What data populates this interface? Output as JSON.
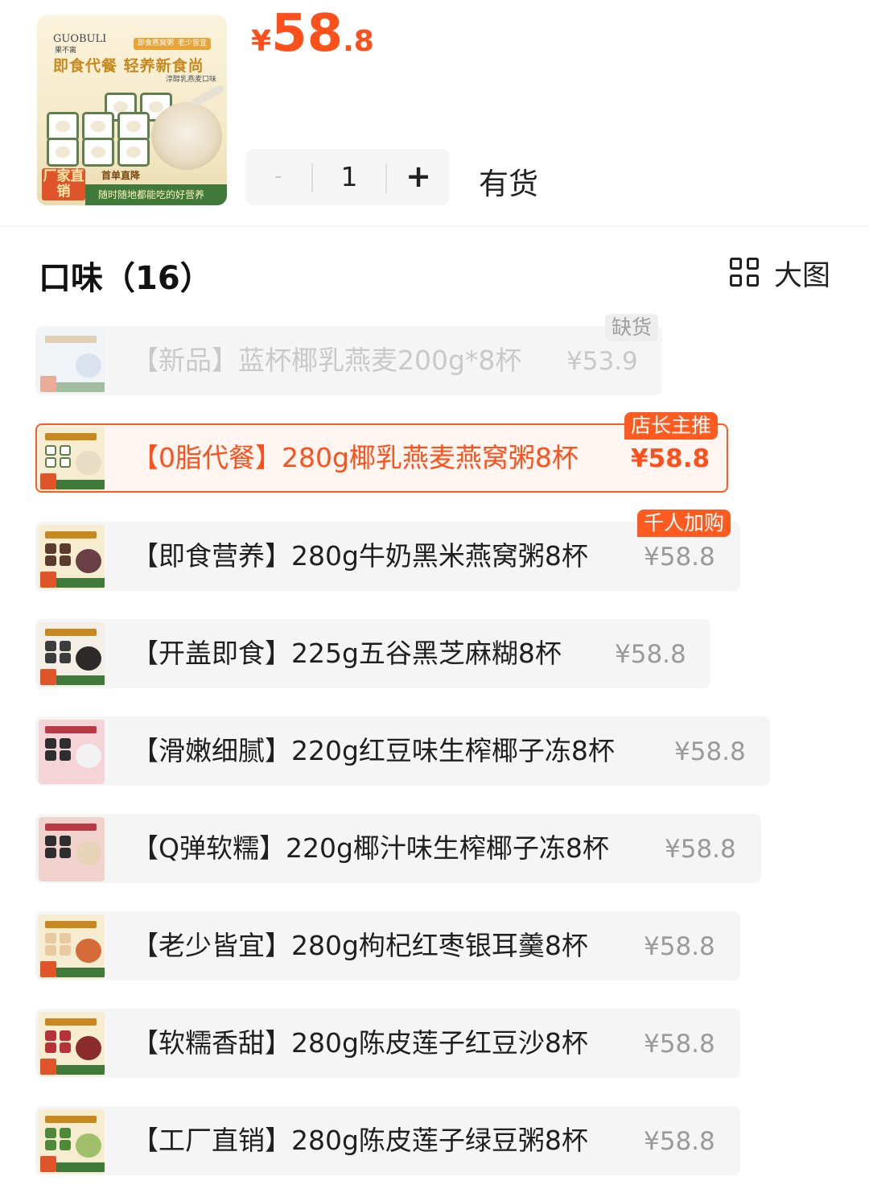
{
  "product": {
    "thumbnail": {
      "brand": "GUOBULI",
      "brand_sub": "果不离",
      "tag_a": "即食燕窝粥",
      "tag_b": "老少皆宜",
      "headline": "即食代餐 轻养新食尚",
      "subline": "淳醇乳燕麦口味",
      "factory": "厂家直销",
      "first_drop": "首单直降",
      "banner": "随时随地都能吃的好营养"
    },
    "price": {
      "currency": "¥",
      "integer": "58",
      "decimal": ".8"
    },
    "stepper": {
      "minus": "-",
      "quantity": "1",
      "plus": "+"
    },
    "stock": "有货"
  },
  "flavors": {
    "title": "口味（16）",
    "big_view_label": "大图",
    "big_view_icon": "grid-icon",
    "items": [
      {
        "label": "【新品】蓝杯椰乳燕麦200g*8杯",
        "price": "¥53.9",
        "badge": "缺货",
        "state": "disabled"
      },
      {
        "label": "【0脂代餐】280g椰乳燕麦燕窝粥8杯",
        "price": "¥58.8",
        "badge": "店长主推",
        "state": "selected"
      },
      {
        "label": "【即食营养】280g牛奶黑米燕窝粥8杯",
        "price": "¥58.8",
        "badge": "千人加购",
        "state": "normal"
      },
      {
        "label": "【开盖即食】225g五谷黑芝麻糊8杯",
        "price": "¥58.8",
        "badge": "",
        "state": "normal"
      },
      {
        "label": "【滑嫩细腻】220g红豆味生榨椰子冻8杯",
        "price": "¥58.8",
        "badge": "",
        "state": "normal"
      },
      {
        "label": "【Q弹软糯】220g椰汁味生榨椰子冻8杯",
        "price": "¥58.8",
        "badge": "",
        "state": "normal"
      },
      {
        "label": "【老少皆宜】280g枸杞红枣银耳羹8杯",
        "price": "¥58.8",
        "badge": "",
        "state": "normal"
      },
      {
        "label": "【软糯香甜】280g陈皮莲子红豆沙8杯",
        "price": "¥58.8",
        "badge": "",
        "state": "normal"
      },
      {
        "label": "【工厂直销】280g陈皮莲子绿豆粥8杯",
        "price": "¥58.8",
        "badge": "",
        "state": "normal"
      }
    ]
  },
  "colors": {
    "accent": "#ff5a1f",
    "price_red": "#ff4f1a",
    "option_bg": "#f5f5f5",
    "selected_bg": "#fff6f2",
    "muted_text": "#9a9a9a"
  }
}
